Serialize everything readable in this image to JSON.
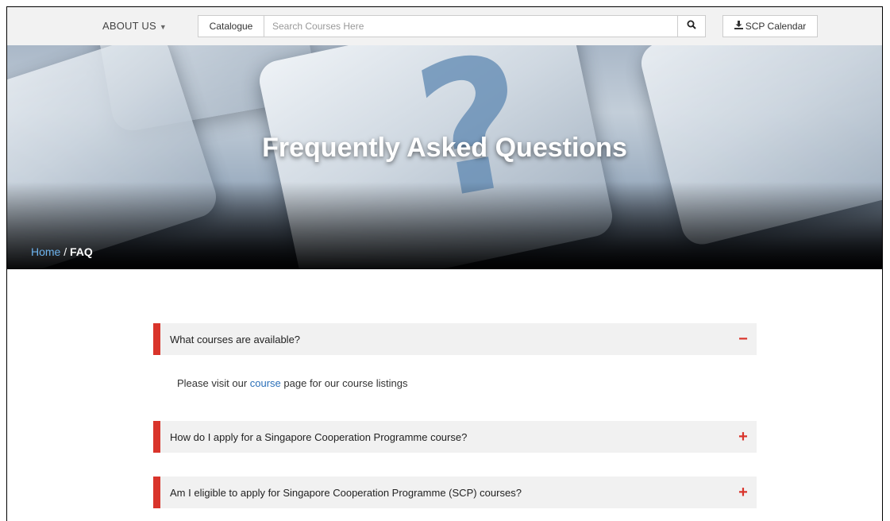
{
  "nav": {
    "about_label": "ABOUT US",
    "catalogue_label": "Catalogue",
    "search_placeholder": "Search Courses Here",
    "calendar_label": "SCP Calendar"
  },
  "hero": {
    "title": "Frequently Asked Questions"
  },
  "breadcrumb": {
    "home": "Home",
    "separator": "/",
    "current": "FAQ"
  },
  "faq": {
    "items": [
      {
        "question": "What courses are available?",
        "toggle": "−",
        "expanded": true,
        "answer_prefix": "Please visit our ",
        "answer_link": "course",
        "answer_suffix": " page for our course listings"
      },
      {
        "question": "How do I apply for a Singapore Cooperation Programme course?",
        "toggle": "+",
        "expanded": false
      },
      {
        "question": "Am I eligible to apply for Singapore Cooperation Programme (SCP) courses?",
        "toggle": "+",
        "expanded": false
      }
    ]
  },
  "colors": {
    "accent": "#d9342b",
    "link": "#2a6fb8",
    "breadcrumb_link": "#6cb3ee"
  },
  "icons": {
    "search": "search-icon",
    "calendar": "download-icon",
    "caret": "caret-down-icon"
  }
}
